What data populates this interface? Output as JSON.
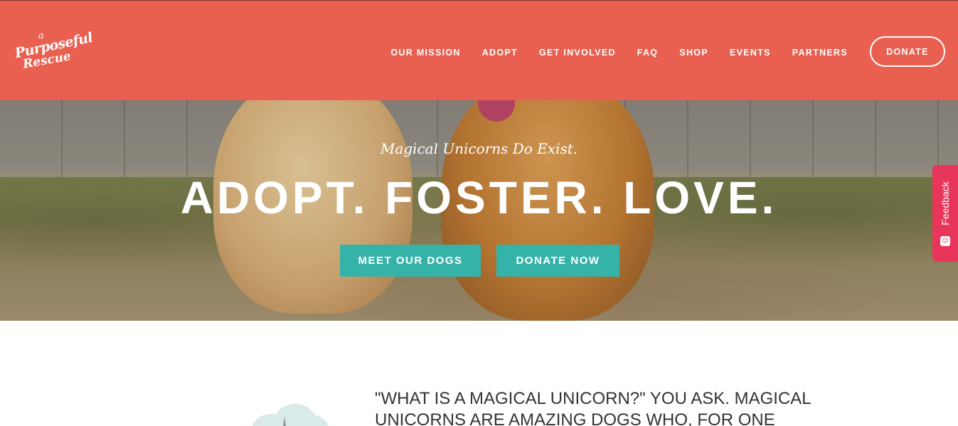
{
  "header": {
    "logo": {
      "line_a": "a",
      "line_1": "Purposeful",
      "line_2": "Rescue"
    },
    "nav": [
      {
        "label": "OUR MISSION"
      },
      {
        "label": "ADOPT"
      },
      {
        "label": "GET INVOLVED"
      },
      {
        "label": "FAQ"
      },
      {
        "label": "SHOP"
      },
      {
        "label": "EVENTS"
      },
      {
        "label": "PARTNERS"
      }
    ],
    "donate_label": "DONATE"
  },
  "hero": {
    "tagline": "Magical Unicorns Do Exist.",
    "title": "ADOPT. FOSTER. LOVE.",
    "buttons": {
      "meet": "MEET OUR DOGS",
      "donate": "DONATE NOW"
    }
  },
  "feedback": {
    "label": "Feedback",
    "icon": "feedback-chat-icon"
  },
  "intro": {
    "text": "\"WHAT IS A MAGICAL UNICORN?\" YOU ASK. MAGICAL UNICORNS ARE AMAZING DOGS WHO, FOR ONE"
  },
  "colors": {
    "header_bg": "#e96050",
    "accent_teal": "#36b3a9",
    "feedback_red": "#e8365a"
  }
}
